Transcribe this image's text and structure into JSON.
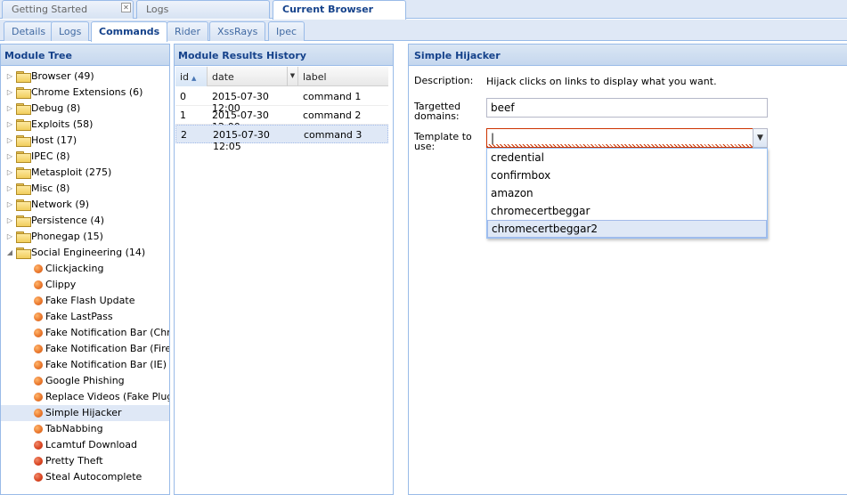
{
  "top_tabs": [
    {
      "label": "Getting Started",
      "closable": true
    },
    {
      "label": "Logs",
      "closable": false
    },
    {
      "label": "Current Browser",
      "active": true
    }
  ],
  "sub_tabs": [
    {
      "label": "Details"
    },
    {
      "label": "Logs"
    },
    {
      "label": "Commands",
      "active": true
    },
    {
      "label": "Rider"
    },
    {
      "label": "XssRays"
    },
    {
      "label": "Ipec"
    }
  ],
  "module_tree": {
    "title": "Module Tree",
    "folders": [
      {
        "label": "Browser (49)",
        "expanded": false
      },
      {
        "label": "Chrome Extensions (6)",
        "expanded": false
      },
      {
        "label": "Debug (8)",
        "expanded": false
      },
      {
        "label": "Exploits (58)",
        "expanded": false
      },
      {
        "label": "Host (17)",
        "expanded": false
      },
      {
        "label": "IPEC (8)",
        "expanded": false
      },
      {
        "label": "Metasploit (275)",
        "expanded": false
      },
      {
        "label": "Misc (8)",
        "expanded": false
      },
      {
        "label": "Network (9)",
        "expanded": false
      },
      {
        "label": "Persistence (4)",
        "expanded": false
      },
      {
        "label": "Phonegap (15)",
        "expanded": false
      },
      {
        "label": "Social Engineering (14)",
        "expanded": true
      }
    ],
    "modules": [
      {
        "label": "Clickjacking",
        "status": "orange"
      },
      {
        "label": "Clippy",
        "status": "orange"
      },
      {
        "label": "Fake Flash Update",
        "status": "orange"
      },
      {
        "label": "Fake LastPass",
        "status": "orange"
      },
      {
        "label": "Fake Notification Bar (Chrome)",
        "status": "orange"
      },
      {
        "label": "Fake Notification Bar (Firefox)",
        "status": "orange"
      },
      {
        "label": "Fake Notification Bar (IE)",
        "status": "orange"
      },
      {
        "label": "Google Phishing",
        "status": "orange"
      },
      {
        "label": "Replace Videos (Fake Plugin)",
        "status": "orange"
      },
      {
        "label": "Simple Hijacker",
        "status": "orange",
        "selected": true
      },
      {
        "label": "TabNabbing",
        "status": "orange"
      },
      {
        "label": "Lcamtuf Download",
        "status": "red"
      },
      {
        "label": "Pretty Theft",
        "status": "red"
      },
      {
        "label": "Steal Autocomplete",
        "status": "red"
      }
    ]
  },
  "results": {
    "title": "Module Results History",
    "columns": [
      "id",
      "date",
      "label"
    ],
    "rows": [
      {
        "id": "0",
        "date": "2015-07-30 12:00",
        "label": "command 1"
      },
      {
        "id": "1",
        "date": "2015-07-30 12:00",
        "label": "command 2"
      },
      {
        "id": "2",
        "date": "2015-07-30 12:05",
        "label": "command 3",
        "selected": true
      }
    ]
  },
  "module_form": {
    "title": "Simple Hijacker",
    "description_label": "Description:",
    "description": "Hijack clicks on links to display what you want.",
    "domains_label_line1": "Targetted",
    "domains_label_line2": "domains:",
    "domains_value": "beef",
    "template_label_line1": "Template to",
    "template_label_line2": "use:",
    "template_value": "|",
    "template_options": [
      "credential",
      "confirmbox",
      "amazon",
      "chromecertbeggar",
      "chromecertbeggar2"
    ],
    "template_highlighted": "chromecertbeggar2"
  },
  "colors": {
    "accent": "#15428b",
    "panel_border": "#99bbe8",
    "selection": "#dfe8f6",
    "invalid": "#cc3300"
  }
}
